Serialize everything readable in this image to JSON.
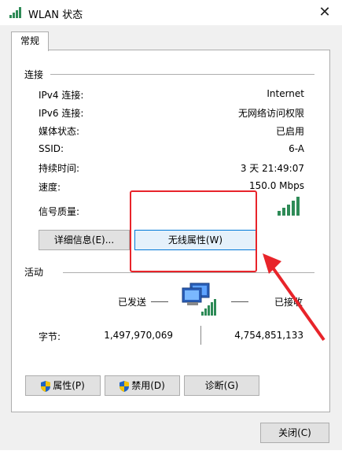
{
  "window": {
    "title": "WLAN 状态",
    "close_glyph": "✕"
  },
  "tab": {
    "label": "常规"
  },
  "connection": {
    "header": "连接",
    "rows": [
      {
        "label": "IPv4 连接:",
        "value": "Internet"
      },
      {
        "label": "IPv6 连接:",
        "value": "无网络访问权限"
      },
      {
        "label": "媒体状态:",
        "value": "已启用"
      },
      {
        "label": "SSID:",
        "value": "6-A"
      },
      {
        "label": "持续时间:",
        "value": "3 天 21:49:07"
      },
      {
        "label": "速度:",
        "value": "150.0 Mbps"
      }
    ],
    "signal_label": "信号质量:",
    "signal_bars": 5,
    "details_button": "详细信息(E)...",
    "wireless_button": "无线属性(W)"
  },
  "activity": {
    "header": "活动",
    "sent_label": "已发送",
    "received_label": "已接收",
    "bytes_label": "字节:",
    "bytes_sent": "1,497,970,069",
    "bytes_received": "4,754,851,133"
  },
  "buttons": {
    "properties": "属性(P)",
    "disable": "禁用(D)",
    "diagnose": "诊断(G)",
    "close": "关闭(C)"
  },
  "colors": {
    "signal": "#2e8b57",
    "annotation": "#e8242a",
    "shield_blue": "#1e63c4",
    "shield_yellow": "#f2c200"
  }
}
